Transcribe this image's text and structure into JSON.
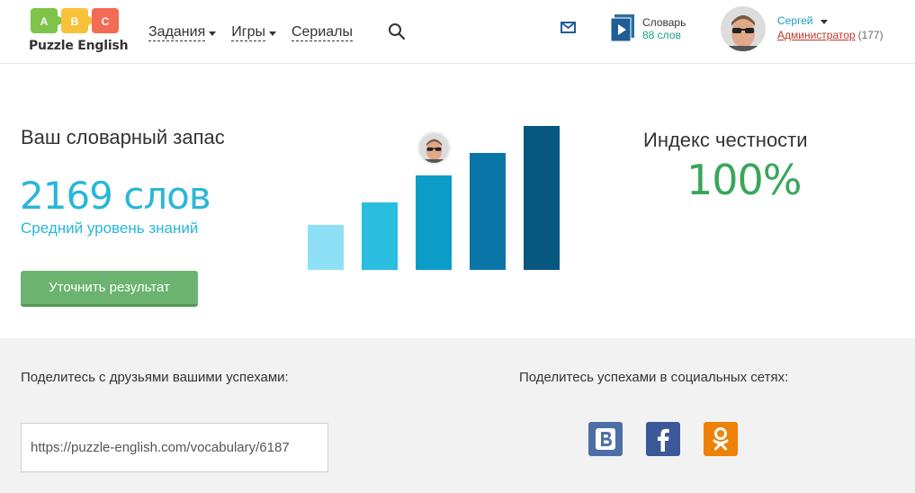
{
  "header": {
    "logo_text": "Puzzle English",
    "logo_letters": [
      "A",
      "B",
      "C"
    ],
    "nav": [
      {
        "label": "Задания",
        "has_caret": true
      },
      {
        "label": "Игры",
        "has_caret": true
      },
      {
        "label": "Сериалы",
        "has_caret": false
      }
    ],
    "dictionary": {
      "title": "Словарь",
      "count": "88 слов"
    },
    "user": {
      "name": "Сергей",
      "role": "Администратор",
      "count": "(177)"
    }
  },
  "main": {
    "title": "Ваш словарный запас",
    "words": "2169 слов",
    "level": "Средний уровень знаний",
    "refine_button": "Уточнить результат",
    "honesty_title": "Индекс честности",
    "honesty_value": "100%"
  },
  "chart_data": {
    "type": "bar",
    "values": [
      50,
      75,
      105,
      130,
      160
    ],
    "colors": [
      "#8ee0f7",
      "#29bde0",
      "#0c9cc8",
      "#0a76a8",
      "#075781"
    ],
    "highlight_index": 2
  },
  "share": {
    "left_title": "Поделитесь с друзьями вашими успехами:",
    "link_value": "https://puzzle-english.com/vocabulary/6187",
    "right_title": "Поделитесь успехами в социальных сетях:",
    "networks": [
      {
        "name": "vk",
        "color": "#4d6fa6"
      },
      {
        "name": "facebook",
        "color": "#3b5998"
      },
      {
        "name": "odnoklassniki",
        "color": "#ee8208"
      }
    ]
  },
  "icons": [
    "logo-puzzle-icon",
    "search-icon",
    "mail-icon",
    "dictionary-icon",
    "user-avatar",
    "vk-icon",
    "facebook-icon",
    "odnoklassniki-icon"
  ]
}
